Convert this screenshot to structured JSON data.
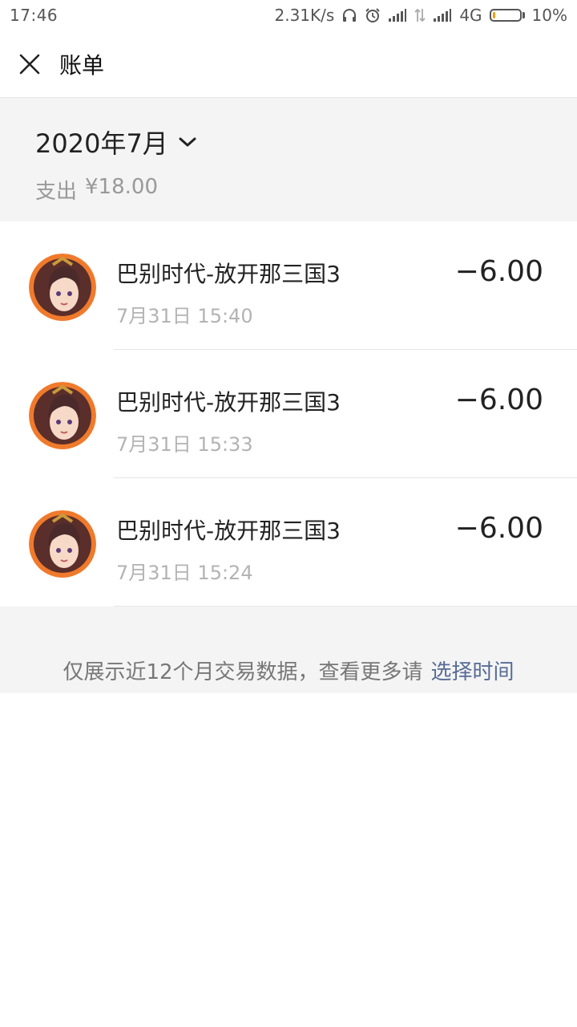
{
  "status_bar": {
    "time": "17:46",
    "net_speed": "2.31K/s",
    "network_type": "4G",
    "battery": "10%",
    "battery_level": 0.1,
    "icons": [
      "headphones-icon",
      "alarm-icon",
      "signal-icon",
      "data-transfer-icon",
      "signal-icon"
    ]
  },
  "header": {
    "title": "账单",
    "close_icon": "close-icon"
  },
  "month": {
    "label": "2020年7月",
    "summary_label": "支出",
    "summary_value": "¥18.00"
  },
  "transactions": [
    {
      "title": "巴别时代-放开那三国3",
      "time": "7月31日 15:40",
      "amount": "−6.00"
    },
    {
      "title": "巴别时代-放开那三国3",
      "time": "7月31日 15:33",
      "amount": "−6.00"
    },
    {
      "title": "巴别时代-放开那三国3",
      "time": "7月31日 15:24",
      "amount": "−6.00"
    }
  ],
  "footer": {
    "text": "仅展示近12个月交易数据，查看更多请",
    "link": "选择时间"
  },
  "colors": {
    "link": "#576b95",
    "section_bg": "#f4f4f4",
    "battery": "#f0a000"
  }
}
